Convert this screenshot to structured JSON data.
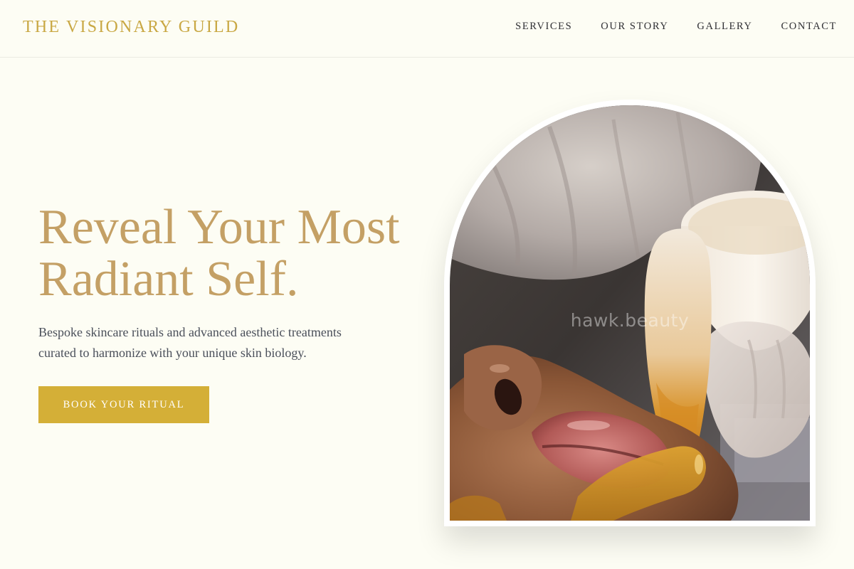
{
  "header": {
    "brand": "THE VISIONARY GUILD",
    "nav": [
      {
        "label": "SERVICES"
      },
      {
        "label": "OUR STORY"
      },
      {
        "label": "GALLERY"
      },
      {
        "label": "CONTACT"
      }
    ]
  },
  "hero": {
    "title_line1": "Reveal Your Most",
    "title_line2": "Radiant Self.",
    "subtitle": "Bespoke skincare rituals and advanced aesthetic treatments curated to harmonize with your unique skin biology.",
    "cta_label": "BOOK YOUR RITUAL"
  },
  "image": {
    "watermark": "hawk.beauty"
  },
  "colors": {
    "background": "#fdfdf4",
    "brand_gold": "#c9a844",
    "headline_gold": "#c4a065",
    "button_gold": "#d4af37",
    "nav_text": "#2f2f33",
    "body_text": "#4a4f5a"
  }
}
